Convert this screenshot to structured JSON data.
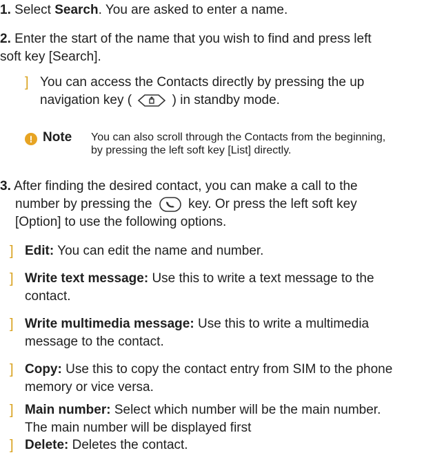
{
  "step1": {
    "number": "1.",
    "pre": "Select ",
    "bold": "Search",
    "post": ". You are asked to enter a name."
  },
  "step2": {
    "number": "2.",
    "line1": "Enter the start of the name that you wish to find and press left",
    "line2": "soft key [Search]."
  },
  "tip": {
    "line1": "You can access the Contacts directly by pressing the up",
    "line2_pre": "navigation key (",
    "line2_post": ") in standby mode."
  },
  "note": {
    "label": "Note",
    "line1": "You can also scroll through the Contacts from the beginning,",
    "line2": "by pressing the left soft key [List] directly."
  },
  "step3": {
    "number": "3.",
    "line1": "After finding the desired contact, you can make a call to the",
    "line2_pre": "number by pressing the",
    "line2_post": "key. Or press the left soft key",
    "line3": "[Option] to use the following options."
  },
  "options": [
    {
      "title": "Edit:",
      "line1": " You can edit the name and number.",
      "line2": ""
    },
    {
      "title": "Write text message:",
      "line1": " Use this to write a text message to the",
      "line2": "contact."
    },
    {
      "title": "Write multimedia message:",
      "line1": " Use this to write a multimedia",
      "line2": "message to the contact."
    },
    {
      "title": "Copy:",
      "line1": " Use this to copy the contact entry from SIM to the phone",
      "line2": "memory or vice versa."
    },
    {
      "title": "Main number:",
      "line1": " Select which number will be the main number.",
      "line2": "The main number will be displayed first"
    },
    {
      "title": "Delete:",
      "line1": " Deletes the contact.",
      "line2": ""
    }
  ],
  "bullet_glyph": "]",
  "colors": {
    "text": "#1f1f1f",
    "bracket": "#d9a21f",
    "info": "#e7a423"
  },
  "icons": {
    "nav": "up-navigation-key-icon",
    "call": "send-call-key-icon",
    "note": "info-icon"
  }
}
